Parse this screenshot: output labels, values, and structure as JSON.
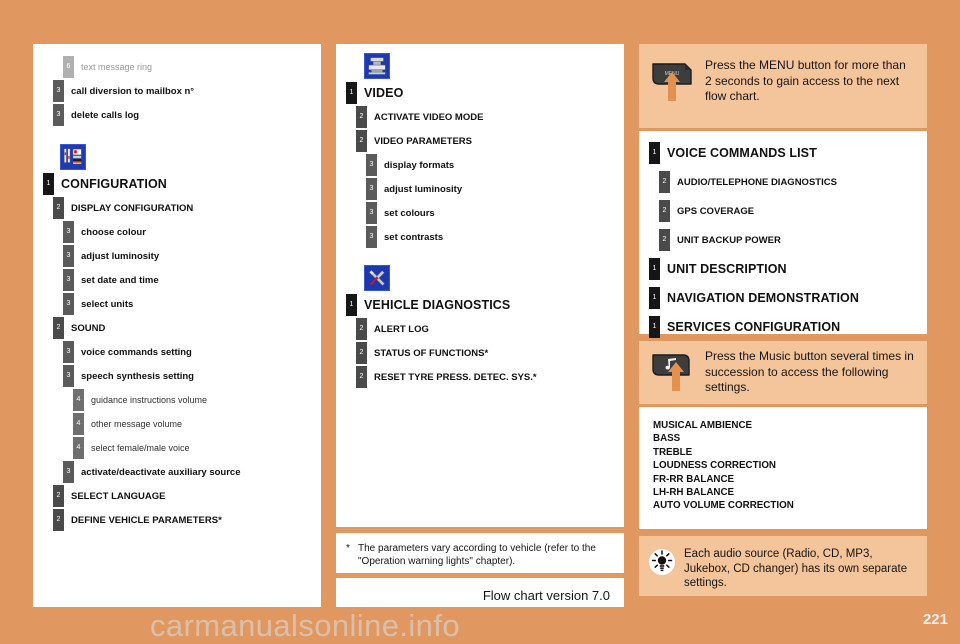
{
  "meta": {
    "page_number": "221",
    "watermark": "carmanualsonline.info",
    "accent_bg": "#e09860",
    "callout_bg": "#f4c49a",
    "panel_bg": "#ffffff",
    "badge_colors": {
      "level1": "#161616",
      "level2": "#4a4a4a",
      "level3": "#5b5b5b",
      "level4": "#6f6f6f",
      "level6": "#b0b0b0"
    }
  },
  "column_left": {
    "top_rows": [
      {
        "level": "6",
        "label": "text message ring"
      },
      {
        "level": "3",
        "label": "call diversion to mailbox n°"
      },
      {
        "level": "3",
        "label": "delete calls log"
      }
    ],
    "configuration": {
      "icon": "configuration-icon",
      "rows": [
        {
          "level": "1",
          "label": "CONFIGURATION"
        },
        {
          "level": "2",
          "label": "DISPLAY CONFIGURATION"
        },
        {
          "level": "3",
          "label": "choose colour"
        },
        {
          "level": "3",
          "label": "adjust luminosity"
        },
        {
          "level": "3",
          "label": "set date and time"
        },
        {
          "level": "3",
          "label": "select units"
        },
        {
          "level": "2",
          "label": "SOUND"
        },
        {
          "level": "3",
          "label": "voice commands setting"
        },
        {
          "level": "3",
          "label": "speech synthesis setting"
        },
        {
          "level": "4",
          "label": "guidance instructions volume"
        },
        {
          "level": "4",
          "label": "other message volume"
        },
        {
          "level": "4",
          "label": "select female/male voice"
        },
        {
          "level": "3",
          "label": "activate/deactivate auxiliary source"
        },
        {
          "level": "2",
          "label": "SELECT LANGUAGE"
        },
        {
          "level": "2",
          "label": "DEFINE VEHICLE PARAMETERS*"
        }
      ]
    }
  },
  "column_middle": {
    "video": {
      "icon": "video-icon",
      "rows": [
        {
          "level": "1",
          "label": "VIDEO"
        },
        {
          "level": "2",
          "label": "ACTIVATE VIDEO MODE"
        },
        {
          "level": "2",
          "label": "VIDEO PARAMETERS"
        },
        {
          "level": "3",
          "label": "display formats"
        },
        {
          "level": "3",
          "label": "adjust luminosity"
        },
        {
          "level": "3",
          "label": "set colours"
        },
        {
          "level": "3",
          "label": "set contrasts"
        }
      ]
    },
    "diagnostics": {
      "icon": "vehicle-diagnostics-icon",
      "rows": [
        {
          "level": "1",
          "label": "VEHICLE DIAGNOSTICS"
        },
        {
          "level": "2",
          "label": "ALERT LOG"
        },
        {
          "level": "2",
          "label": "STATUS OF FUNCTIONS*"
        },
        {
          "level": "2",
          "label": "RESET TYRE PRESS. DETEC. SYS.*"
        }
      ]
    },
    "footnote": {
      "marker": "*",
      "text": "The parameters vary according to vehicle (refer to the \"Operation warning lights\" chapter)."
    },
    "version_label": "Flow chart version 7.0"
  },
  "column_right": {
    "menu_callout": {
      "icon": "menu-button-icon",
      "button_label": "MENU",
      "text": "Press the MENU button for more than 2 seconds to gain access to the next flow chart."
    },
    "menu_rows": [
      {
        "level": "1",
        "label": "VOICE COMMANDS LIST"
      },
      {
        "level": "2",
        "label": "AUDIO/TELEPHONE DIAGNOSTICS"
      },
      {
        "level": "2",
        "label": "GPS COVERAGE"
      },
      {
        "level": "2",
        "label": "UNIT BACKUP POWER"
      },
      {
        "level": "1",
        "label": "UNIT DESCRIPTION"
      },
      {
        "level": "1",
        "label": "NAVIGATION DEMONSTRATION"
      },
      {
        "level": "1",
        "label": "SERVICES CONFIGURATION"
      }
    ],
    "music_callout": {
      "icon": "music-button-icon",
      "text": "Press the Music button several times in succession to access the following settings."
    },
    "music_settings": [
      "MUSICAL AMBIENCE",
      "BASS",
      "TREBLE",
      "LOUDNESS CORRECTION",
      "FR-RR BALANCE",
      "LH-RH BALANCE",
      "AUTO VOLUME CORRECTION"
    ],
    "tip": {
      "icon": "bulb-icon",
      "text": "Each audio source (Radio, CD, MP3, Jukebox, CD changer) has its own separate settings."
    }
  }
}
